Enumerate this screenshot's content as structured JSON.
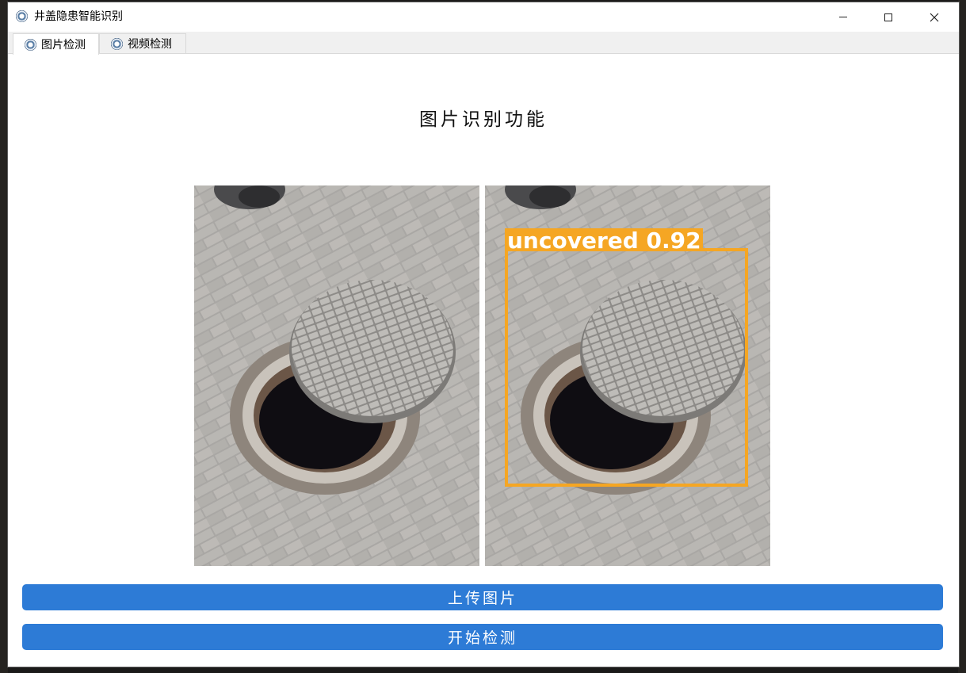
{
  "window": {
    "title": "井盖隐患智能识别",
    "controls": {
      "minimize": "minimize-icon",
      "maximize": "maximize-icon",
      "close": "close-icon"
    }
  },
  "tabs": [
    {
      "label": "图片检测",
      "icon": "app-logo-icon",
      "active": true
    },
    {
      "label": "视频检测",
      "icon": "app-logo-icon",
      "active": false
    }
  ],
  "main": {
    "heading": "图片识别功能",
    "input_image": {
      "description_icon": "manhole-photo"
    },
    "result_image": {
      "detection": {
        "label": "uncovered",
        "confidence": "0.92",
        "box_color": "#f5a623"
      }
    },
    "upload_button": "上传图片",
    "detect_button": "开始检测"
  },
  "colors": {
    "accent": "#2d7bd6",
    "detection_box": "#f5a623"
  }
}
